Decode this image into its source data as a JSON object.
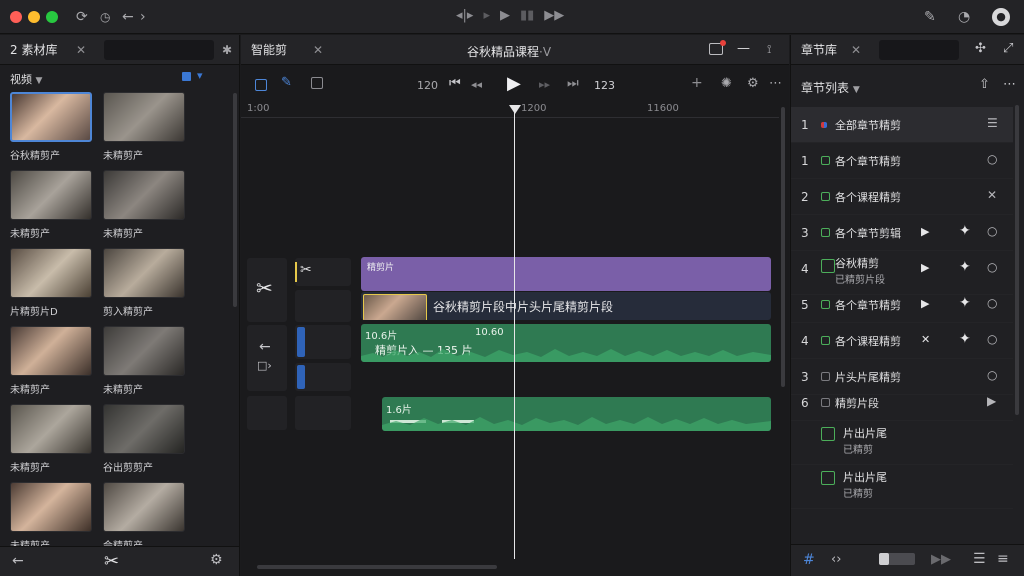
{
  "titlebar": {
    "traffic_lights": [
      "#ff5f57",
      "#febc2e",
      "#28c840"
    ],
    "transport": [
      "◂|▸",
      "▸",
      "▶",
      "▮▮",
      "▶▶"
    ]
  },
  "left": {
    "tab_label": "素材库",
    "tab_prefix": "2",
    "filter_label": "视频",
    "thumbnails": [
      {
        "label": "谷秋精剪产",
        "selected": true
      },
      {
        "label": "未精剪产"
      },
      {
        "label": "未精剪产"
      },
      {
        "label": "未精剪产"
      },
      {
        "label": "片精剪片D"
      },
      {
        "label": "剪入精剪产"
      },
      {
        "label": "未精剪产"
      },
      {
        "label": "未精剪产"
      },
      {
        "label": "未精剪产"
      },
      {
        "label": "谷出剪剪产"
      },
      {
        "label": "未精剪产"
      },
      {
        "label": "会精剪产"
      }
    ]
  },
  "center": {
    "tab_label": "智能剪",
    "project_title": "谷秋精品课程",
    "project_suffix": "·V",
    "timecode_left": "120",
    "timecode_right": "123",
    "ruler": {
      "t0": "1:00",
      "t1": "1200",
      "t2": "11600"
    },
    "video_track": {
      "header": "精剪片",
      "caption": "谷秋精剪片段中片头片尾精剪片段"
    },
    "audio_track1": {
      "label1": "10.6片",
      "label2": "10.60",
      "caption": "精剪片入 — 135 片"
    },
    "audio_track2": {
      "label": "1.6片"
    }
  },
  "right": {
    "tab_label": "章节库",
    "filter_label": "章节列表",
    "rows": [
      {
        "num": "1",
        "label": "全部章节精剪",
        "selected": true
      },
      {
        "num": "1",
        "label": "各个章节精剪"
      },
      {
        "num": "2",
        "label": "各个课程精剪"
      },
      {
        "num": "3",
        "label": "各个章节剪辑"
      },
      {
        "num": "4",
        "label": "谷秋精剪",
        "sub": "已精剪片段"
      },
      {
        "num": "5",
        "label": "各个章节精剪"
      },
      {
        "num": "4",
        "label": "各个课程精剪"
      },
      {
        "num": "3",
        "label": "片头片尾精剪"
      },
      {
        "num": "6",
        "label": "精剪片段"
      },
      {
        "num": "",
        "label": "片出片尾",
        "sub": "已精剪"
      },
      {
        "num": "",
        "label": "片出片尾",
        "sub": "已精剪"
      }
    ]
  }
}
